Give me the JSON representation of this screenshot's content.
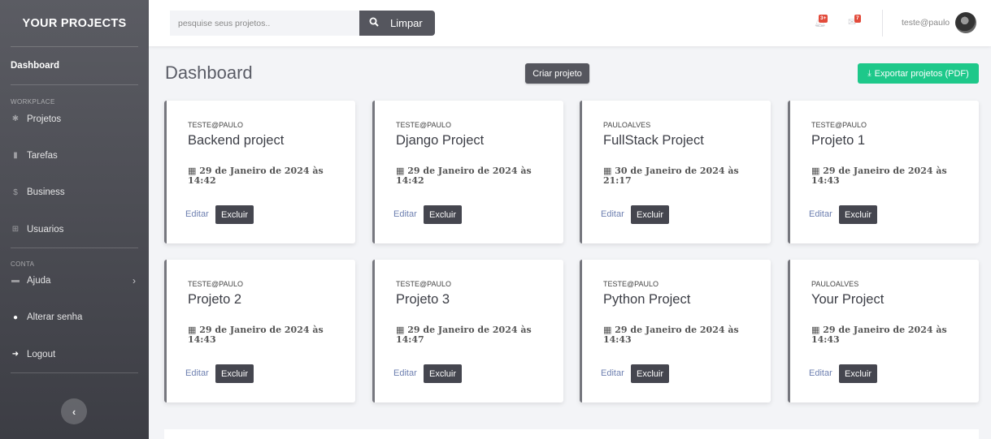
{
  "sidebar": {
    "brand": "YOUR PROJECTS",
    "active": "Dashboard",
    "workplace_head": "WORKPLACE",
    "conta_head": "CONTA",
    "items": [
      {
        "label": "Projetos",
        "icon": "gear-icon"
      },
      {
        "label": "Tarefas",
        "icon": "clipboard-icon"
      },
      {
        "label": "Business",
        "icon": "dollar-icon"
      },
      {
        "label": "Usuarios",
        "icon": "table-icon"
      },
      {
        "label": "Ajuda",
        "icon": "folder-icon"
      },
      {
        "label": "Alterar senha",
        "icon": "user-icon"
      },
      {
        "label": "Logout",
        "icon": "sign-out-icon"
      }
    ],
    "toggle_glyph": "‹"
  },
  "topbar": {
    "search_placeholder": "pesquise seus projetos..",
    "clear_label": "Limpar",
    "bell_badge": "3+",
    "mail_badge": "7",
    "username": "teste@paulo"
  },
  "header": {
    "title": "Dashboard",
    "create_label": "Criar projeto",
    "export_label": "Exportar projetos (PDF)"
  },
  "card_actions": {
    "edit": "Editar",
    "delete": "Excluir"
  },
  "projects": [
    {
      "owner": "TESTE@PAULO",
      "name": "Backend project",
      "date": "29 de Janeiro de 2024 às 14:42"
    },
    {
      "owner": "TESTE@PAULO",
      "name": "Django Project",
      "date": "29 de Janeiro de 2024 às 14:42"
    },
    {
      "owner": "PAULOALVES",
      "name": "FullStack Project",
      "date": "30 de Janeiro de 2024 às 21:17"
    },
    {
      "owner": "TESTE@PAULO",
      "name": "Projeto 1",
      "date": "29 de Janeiro de 2024 às 14:43"
    },
    {
      "owner": "TESTE@PAULO",
      "name": "Projeto 2",
      "date": "29 de Janeiro de 2024 às 14:43"
    },
    {
      "owner": "TESTE@PAULO",
      "name": "Projeto 3",
      "date": "29 de Janeiro de 2024 às 14:47"
    },
    {
      "owner": "TESTE@PAULO",
      "name": "Python Project",
      "date": "29 de Janeiro de 2024 às 14:43"
    },
    {
      "owner": "PAULOALVES",
      "name": "Your Project",
      "date": "29 de Janeiro de 2024 às 14:43"
    }
  ]
}
